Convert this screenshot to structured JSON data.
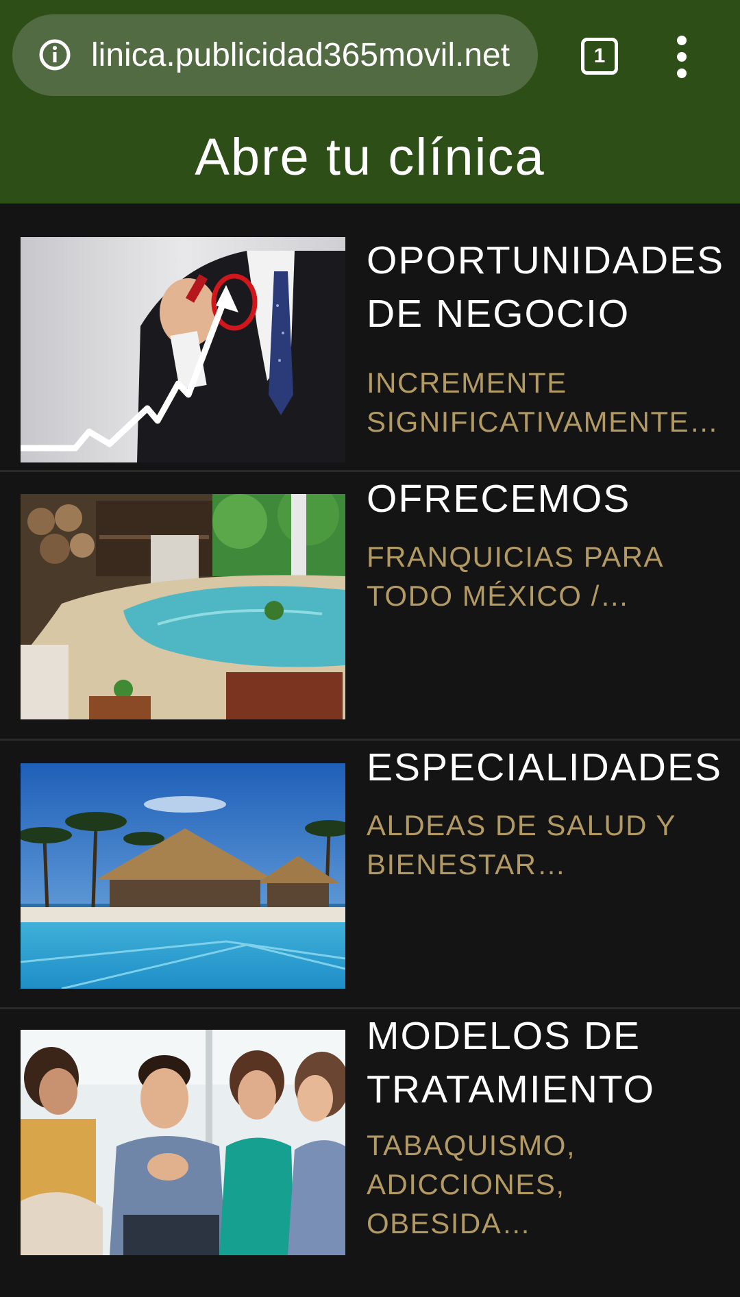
{
  "browser": {
    "url": "linica.publicidad365movil.net",
    "tab_count": "1",
    "info_icon": "info-icon",
    "menu_icon": "more-vert-icon"
  },
  "header": {
    "title": "Abre tu clínica"
  },
  "items": [
    {
      "title": "OPORTUNIDADES DE NEGOCIO",
      "subtitle": "INCREMENTE SIGNIFICATIVAMENTE…",
      "image": "businessman-growth-chart-image"
    },
    {
      "title": "OFRECEMOS",
      "subtitle": "FRANQUICIAS PARA TODO MÉXICO /…",
      "image": "spa-pool-image"
    },
    {
      "title": "ESPECIALIDADES",
      "subtitle": "ALDEAS DE SALUD Y BIENESTAR…",
      "image": "beach-resort-pool-image"
    },
    {
      "title": "MODELOS DE TRATAMIENTO",
      "subtitle": "TABAQUISMO, ADICCIONES, OBESIDA…",
      "image": "group-therapy-image"
    }
  ],
  "colors": {
    "header_bg": "#2e4e17",
    "urlbar_bg": "#526b42",
    "page_bg": "#141414",
    "title_text": "#ffffff",
    "subtitle_text": "#b39a62"
  }
}
